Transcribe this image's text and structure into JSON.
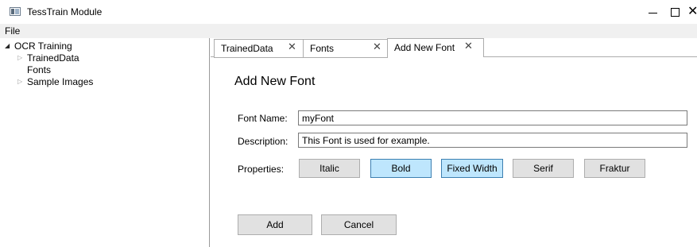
{
  "window": {
    "title": "TessTrain Module",
    "controls": {
      "minimize": "minimize-icon",
      "maximize": "maximize-icon",
      "close": "close-icon",
      "close_glyph": "✕"
    }
  },
  "menu": {
    "file_label": "File"
  },
  "tree": {
    "root": {
      "label": "OCR Training",
      "expanded": true
    },
    "children": [
      {
        "label": "TrainedData",
        "expandable": true
      },
      {
        "label": "Fonts",
        "expandable": false
      },
      {
        "label": "Sample Images",
        "expandable": true
      }
    ],
    "arrow_open": "◢",
    "arrow_closed": "▷"
  },
  "tabs": [
    {
      "label": "TrainedData",
      "close": "✕",
      "active": false
    },
    {
      "label": "Fonts",
      "close": "✕",
      "active": false
    },
    {
      "label": "Add New Font",
      "close": "✕",
      "active": true
    }
  ],
  "form": {
    "title": "Add New Font",
    "font_name_label": "Font Name:",
    "font_name_value": "myFont",
    "description_label": "Description:",
    "description_value": "This Font is used for example.",
    "properties_label": "Properties:",
    "properties": [
      {
        "label": "Italic",
        "selected": false
      },
      {
        "label": "Bold",
        "selected": true
      },
      {
        "label": "Fixed Width",
        "selected": true
      },
      {
        "label": "Serif",
        "selected": false
      },
      {
        "label": "Fraktur",
        "selected": false
      }
    ],
    "add_label": "Add",
    "cancel_label": "Cancel"
  },
  "colors": {
    "selected_toggle": "#bee6fd",
    "selected_toggle_border": "#3c7fb1",
    "button_face": "#e1e1e1",
    "menubar": "#f0f0f0"
  }
}
